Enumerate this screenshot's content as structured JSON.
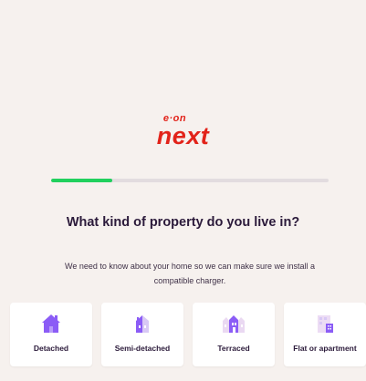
{
  "brand": {
    "logo_top": "e·on",
    "logo_main": "next",
    "color": "#e2231a"
  },
  "progress": {
    "fraction": 0.22,
    "fill_color": "#21d05e",
    "track_color": "#e2dcdf"
  },
  "question": {
    "title": "What kind of property do you live in?",
    "description": "We need to know about your home so we can make sure we install a compatible charger."
  },
  "property_options": [
    {
      "label": "Detached",
      "icon": "detached-house-icon"
    },
    {
      "label": "Semi-detached",
      "icon": "semi-detached-house-icon"
    },
    {
      "label": "Terraced",
      "icon": "terraced-house-icon"
    },
    {
      "label": "Flat or apartment",
      "icon": "apartment-building-icon"
    }
  ],
  "colors": {
    "background": "#f6f1ee",
    "card": "#ffffff",
    "icon_purple": "#8b5cf6",
    "icon_light_purple": "#d8c8f5",
    "text_dark": "#2b1a3a"
  }
}
